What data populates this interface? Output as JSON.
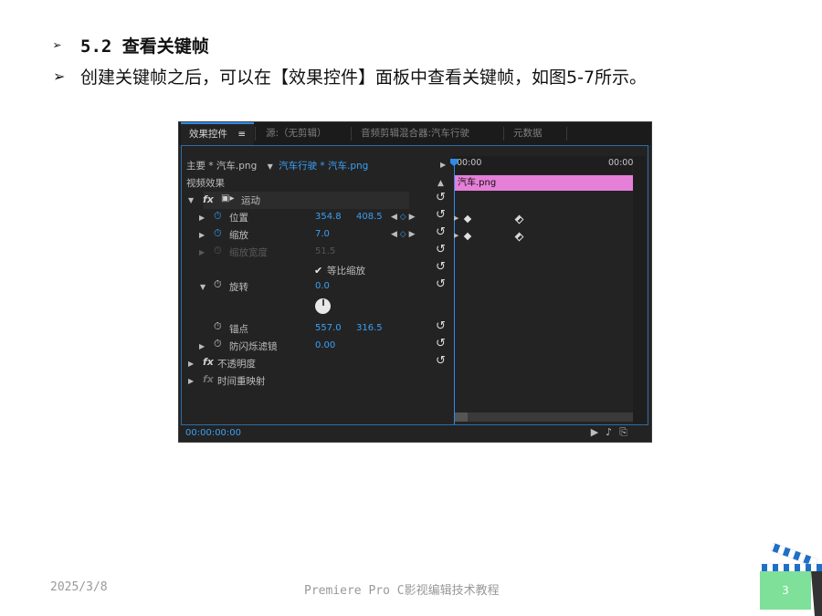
{
  "slide": {
    "bullet1": "5.2 查看关键帧",
    "bullet2": "创建关键帧之后，可以在【效果控件】面板中查看关键帧，如图5-7所示。",
    "date": "2025/3/8",
    "footer": "Premiere Pro C影视编辑技术教程",
    "page": "3"
  },
  "panel": {
    "tabs": [
      "效果控件",
      "源:（无剪辑）",
      "音频剪辑混合器:汽车行驶",
      "元数据"
    ],
    "tab_menu": "≡",
    "clip_master": "主要 * 汽车.png",
    "clip_seq": "汽车行驶 * 汽车.png",
    "section": "视频效果",
    "timeline_start": "00:00",
    "timeline_end": "00:00",
    "clip_name": "汽车.png",
    "current_time": "00:00:00:00",
    "effects": {
      "motion": "运动",
      "position": {
        "label": "位置",
        "x": "354.8",
        "y": "408.5"
      },
      "scale": {
        "label": "缩放",
        "value": "7.0"
      },
      "scale_width": {
        "label": "缩放宽度",
        "value": "51.5"
      },
      "uniform_scale": "等比缩放",
      "rotation": {
        "label": "旋转",
        "value": "0.0"
      },
      "anchor": {
        "label": "锚点",
        "x": "557.0",
        "y": "316.5"
      },
      "antiflicker": {
        "label": "防闪烁滤镜",
        "value": "0.00"
      },
      "opacity": "不透明度",
      "time_remap": "时间重映射"
    },
    "fx_symbol": "fx"
  }
}
